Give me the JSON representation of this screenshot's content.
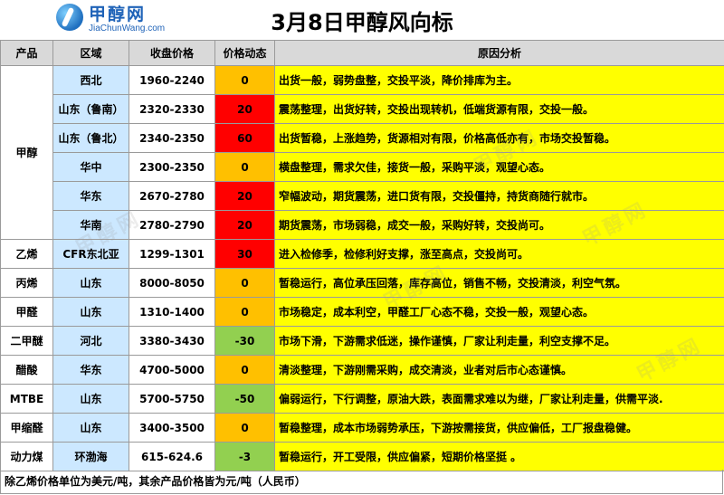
{
  "header": {
    "logo_cn": "甲醇网",
    "logo_en": "JiaChunWang.com",
    "title": "3月8日甲醇风向标"
  },
  "table": {
    "columns": [
      "产品",
      "区域",
      "收盘价格",
      "价格动态",
      "原因分析"
    ],
    "groups": [
      {
        "product": "甲醇",
        "rows": [
          {
            "region": "西北",
            "price": "1960-2240",
            "change": "0",
            "change_color": "#ffc000",
            "analysis": "出货一般，弱势盘整，交投平淡，降价排库为主。"
          },
          {
            "region": "山东（鲁南）",
            "price": "2320-2330",
            "change": "20",
            "change_color": "#ff0000",
            "analysis": "震荡整理，出货好转，交投出现转机，低端货源有限，交投一般。"
          },
          {
            "region": "山东（鲁北）",
            "price": "2340-2350",
            "change": "60",
            "change_color": "#ff0000",
            "analysis": "出货暂稳，上涨趋势，货源相对有限，价格高低亦有，市场交投暂稳。"
          },
          {
            "region": "华中",
            "price": "2300-2350",
            "change": "0",
            "change_color": "#ffc000",
            "analysis": "横盘整理，需求欠佳，接货一般，采购平淡，观望心态。"
          },
          {
            "region": "华东",
            "price": "2670-2780",
            "change": "20",
            "change_color": "#ff0000",
            "analysis": "窄幅波动，期货震荡，进口货有限，交投僵持，持货商随行就市。"
          },
          {
            "region": "华南",
            "price": "2780-2790",
            "change": "20",
            "change_color": "#ff0000",
            "analysis": "期货震荡，市场弱稳，成交一般，采购好转，交投尚可。"
          }
        ]
      },
      {
        "product": "乙烯",
        "rows": [
          {
            "region": "CFR东北亚",
            "price": "1299-1301",
            "change": "30",
            "change_color": "#ff0000",
            "analysis": "进入检修季，检修利好支撑，涨至高点，交投尚可。"
          }
        ]
      },
      {
        "product": "丙烯",
        "rows": [
          {
            "region": "山东",
            "price": "8000-8050",
            "change": "0",
            "change_color": "#ffc000",
            "analysis": "暂稳运行，高位承压回落，库存高位，销售不畅，交投清淡，利空气氛。"
          }
        ]
      },
      {
        "product": "甲醛",
        "rows": [
          {
            "region": "山东",
            "price": "1310-1400",
            "change": "0",
            "change_color": "#ffc000",
            "analysis": "市场稳定，成本利空，甲醛工厂心态不稳，交投一般，观望心态。"
          }
        ]
      },
      {
        "product": "二甲醚",
        "rows": [
          {
            "region": "河北",
            "price": "3380-3430",
            "change": "-30",
            "change_color": "#92d050",
            "analysis": "市场下滑，下游需求低迷，操作谨慎，厂家让利走量，利空支撑不足。"
          }
        ]
      },
      {
        "product": "醋酸",
        "rows": [
          {
            "region": "华东",
            "price": "4700-5000",
            "change": "0",
            "change_color": "#ffc000",
            "analysis": "清淡整理，下游刚需采购，成交清淡，业者对后市心态谨慎。"
          }
        ]
      },
      {
        "product": "MTBE",
        "rows": [
          {
            "region": "山东",
            "price": "5700-5750",
            "change": "-50",
            "change_color": "#92d050",
            "analysis": "偏弱运行，下行调整，原油大跌，表面需求难以为继，厂家让利走量，供需平淡."
          }
        ]
      },
      {
        "product": "甲缩醛",
        "rows": [
          {
            "region": "山东",
            "price": "3400-3500",
            "change": "0",
            "change_color": "#ffc000",
            "analysis": "暂稳整理，成本市场弱势承压，下游按需接货，供应偏低，工厂报盘稳健。"
          }
        ]
      },
      {
        "product": "动力煤",
        "rows": [
          {
            "region": "环渤海",
            "price": "615-624.6",
            "change": "-3",
            "change_color": "#92d050",
            "analysis": "暂稳运行，开工受限，供应偏紧，短期价格坚挺 。"
          }
        ]
      }
    ]
  },
  "footer": {
    "note": "除乙烯价格单位为美元/吨，其余产品价格皆为元/吨（人民币）"
  },
  "colors": {
    "region_bg": "#cce8ff",
    "price_bg": "#ffffff",
    "analysis_bg": "#ffff00",
    "header_bg": "#d9d9d9"
  },
  "watermark": "甲醇网"
}
